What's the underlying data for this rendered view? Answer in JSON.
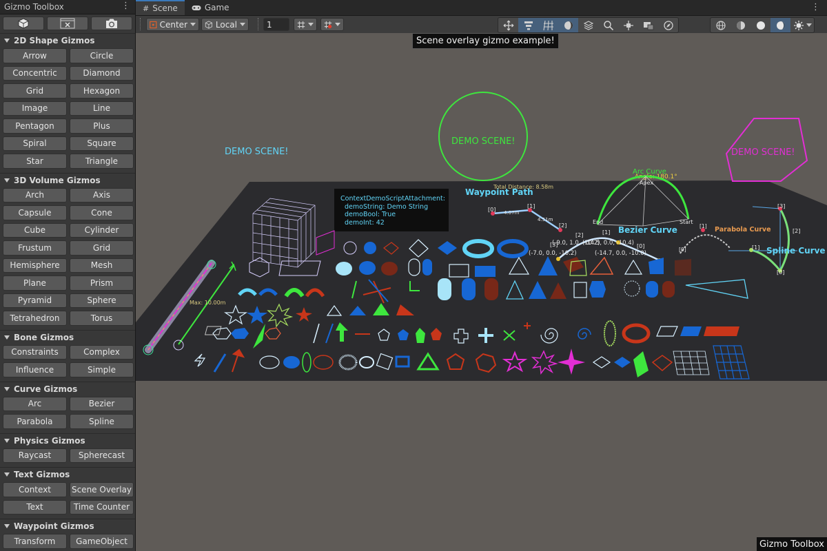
{
  "left_panel": {
    "title": "Gizmo Toolbox",
    "top_icons": [
      "cube-icon",
      "x-box-icon",
      "camera-icon"
    ],
    "sections": [
      {
        "title": "2D Shape Gizmos",
        "buttons": [
          "Arrow",
          "Circle",
          "Concentric",
          "Diamond",
          "Grid",
          "Hexagon",
          "Image",
          "Line",
          "Pentagon",
          "Plus",
          "Spiral",
          "Square",
          "Star",
          "Triangle"
        ]
      },
      {
        "title": "3D Volume Gizmos",
        "buttons": [
          "Arch",
          "Axis",
          "Capsule",
          "Cone",
          "Cube",
          "Cylinder",
          "Frustum",
          "Grid",
          "Hemisphere",
          "Mesh",
          "Plane",
          "Prism",
          "Pyramid",
          "Sphere",
          "Tetrahedron",
          "Torus"
        ]
      },
      {
        "title": "Bone Gizmos",
        "buttons": [
          "Constraints",
          "Complex",
          "Influence",
          "Simple"
        ]
      },
      {
        "title": "Curve Gizmos",
        "buttons": [
          "Arc",
          "Bezier",
          "Parabola",
          "Spline"
        ]
      },
      {
        "title": "Physics Gizmos",
        "buttons": [
          "Raycast",
          "Spherecast"
        ]
      },
      {
        "title": "Text Gizmos",
        "buttons": [
          "Context",
          "Scene Overlay",
          "Text",
          "Time Counter"
        ]
      },
      {
        "title": "Waypoint Gizmos",
        "buttons": [
          "Transform",
          "GameObject"
        ]
      }
    ]
  },
  "tabs": [
    {
      "label": "Scene",
      "icon": "grid-icon",
      "active": true
    },
    {
      "label": "Game",
      "icon": "gamepad-icon",
      "active": false
    }
  ],
  "toolbar": {
    "pivot": "Center",
    "space": "Local",
    "grid_size": "1"
  },
  "scene": {
    "banner": "Scene overlay gizmo example!",
    "watermark": "Gizmo Toolbox",
    "demo_labels": [
      "DEMO SCENE!",
      "DEMO SCENE!",
      "DEMO SCENE!"
    ],
    "context_box": [
      "ContextDemoScriptAttachment:",
      "demoString: Demo String",
      "demoBool: True",
      "demoInt: 42"
    ],
    "waypoint_title": "Waypoint Path",
    "total_distance": "Total Distance: 8.58m",
    "waypoint_labels": [
      "[0]",
      "4.07m",
      "[1]",
      "4.51m",
      "[2]"
    ],
    "arc_curve": "Arc Curve",
    "arc_angle": "Angle: 180.1°",
    "apex": "Apex",
    "end": "End",
    "start": "Start",
    "bezier_curve": "Bezier Curve",
    "bezier_points": [
      "(-9.0, 1.0, -10.2)",
      "(-14.5, 0.0, -10.4)",
      "(-7.0, 0.0, -10.2)",
      "(-14.7, 0.0, -10.0)",
      "[3]",
      "[2]",
      "[1]",
      "[0]"
    ],
    "parabola_curve": "Parabola Curve",
    "spline_curve": "Spline Curve",
    "spline_labels": [
      "[3]",
      "[2]",
      "[1]",
      "[0]",
      "[0]",
      "[1]"
    ],
    "capsule_max": "Max: 10.00m"
  },
  "colors": {
    "accent": "#3a79bb",
    "scene_bg": "#5f5b57",
    "ground": "#2b2b2e",
    "cyan": "#61d4f6",
    "green": "#3ee63e",
    "magenta": "#e22ed4",
    "blue": "#1767d4",
    "red": "#c8361a",
    "lime": "#8ae62a"
  }
}
